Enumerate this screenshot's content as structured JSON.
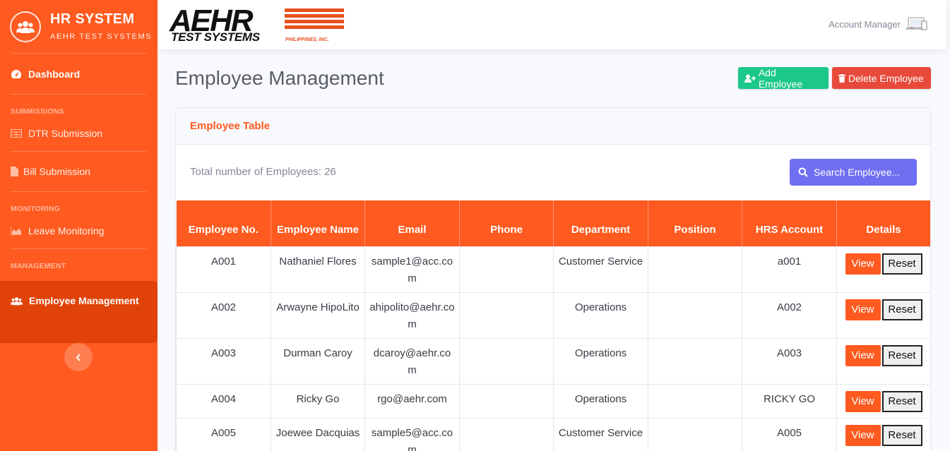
{
  "sidebar": {
    "brand_title": "HR SYSTEM",
    "brand_subtitle": "AEHR TEST SYSTEMS",
    "dashboard": "Dashboard",
    "heading_submissions": "SUBMISSIONS",
    "dtr_submission": "DTR Submission",
    "bill_submission": "Bill Submission",
    "heading_monitoring": "MONITORING",
    "leave_monitoring": "Leave Monitoring",
    "heading_management": "MANAGEMENT",
    "employee_management": "Employee Management"
  },
  "topbar": {
    "logo_main": "AEHR",
    "logo_sub": "TEST SYSTEMS",
    "logo_country": "PHILIPPINES, INC.",
    "account_label": "Account Manager"
  },
  "page": {
    "title": "Employee Management",
    "add_button": "Add Employee",
    "delete_button": "Delete Employee"
  },
  "card": {
    "header": "Employee Table",
    "total_text": "Total number of Employees: 26",
    "search_button": "Search Employee..."
  },
  "table": {
    "columns": [
      "Employee No.",
      "Employee Name",
      "Email",
      "Phone",
      "Department",
      "Position",
      "HRS Account",
      "Details"
    ],
    "rows": [
      {
        "no": "A001",
        "name": "Nathaniel Flores",
        "email": "sample1@acc.com",
        "phone": "",
        "department": "Customer Service",
        "position": "",
        "hrs": "a001"
      },
      {
        "no": "A002",
        "name": "Arwayne HipoLito",
        "email": "ahipolito@aehr.com",
        "phone": "",
        "department": "Operations",
        "position": "",
        "hrs": "A002"
      },
      {
        "no": "A003",
        "name": "Durman Caroy",
        "email": "dcaroy@aehr.com",
        "phone": "",
        "department": "Operations",
        "position": "",
        "hrs": "A003"
      },
      {
        "no": "A004",
        "name": "Ricky Go",
        "email": "rgo@aehr.com",
        "phone": "",
        "department": "Operations",
        "position": "",
        "hrs": "RICKY GO"
      },
      {
        "no": "A005",
        "name": "Joewee Dacquias",
        "email": "sample5@acc.com",
        "phone": "",
        "department": "Customer Service",
        "position": "",
        "hrs": "A005"
      }
    ],
    "view_label": "View",
    "reset_label": "Reset"
  },
  "colors": {
    "accent": "#ff5a1f",
    "accent_dark": "#e04207",
    "success": "#1cc88a",
    "danger": "#e74a3b",
    "search": "#6f6ff2"
  },
  "icons": {
    "brand": "users-icon",
    "dashboard": "tachometer-icon",
    "dtr": "table-icon",
    "bill": "file-icon",
    "leave": "area-chart-icon",
    "employee": "users-icon",
    "toggle": "chevron-left-icon",
    "account": "computer-icon",
    "add": "user-plus-icon",
    "delete": "trash-icon",
    "search": "search-icon"
  }
}
